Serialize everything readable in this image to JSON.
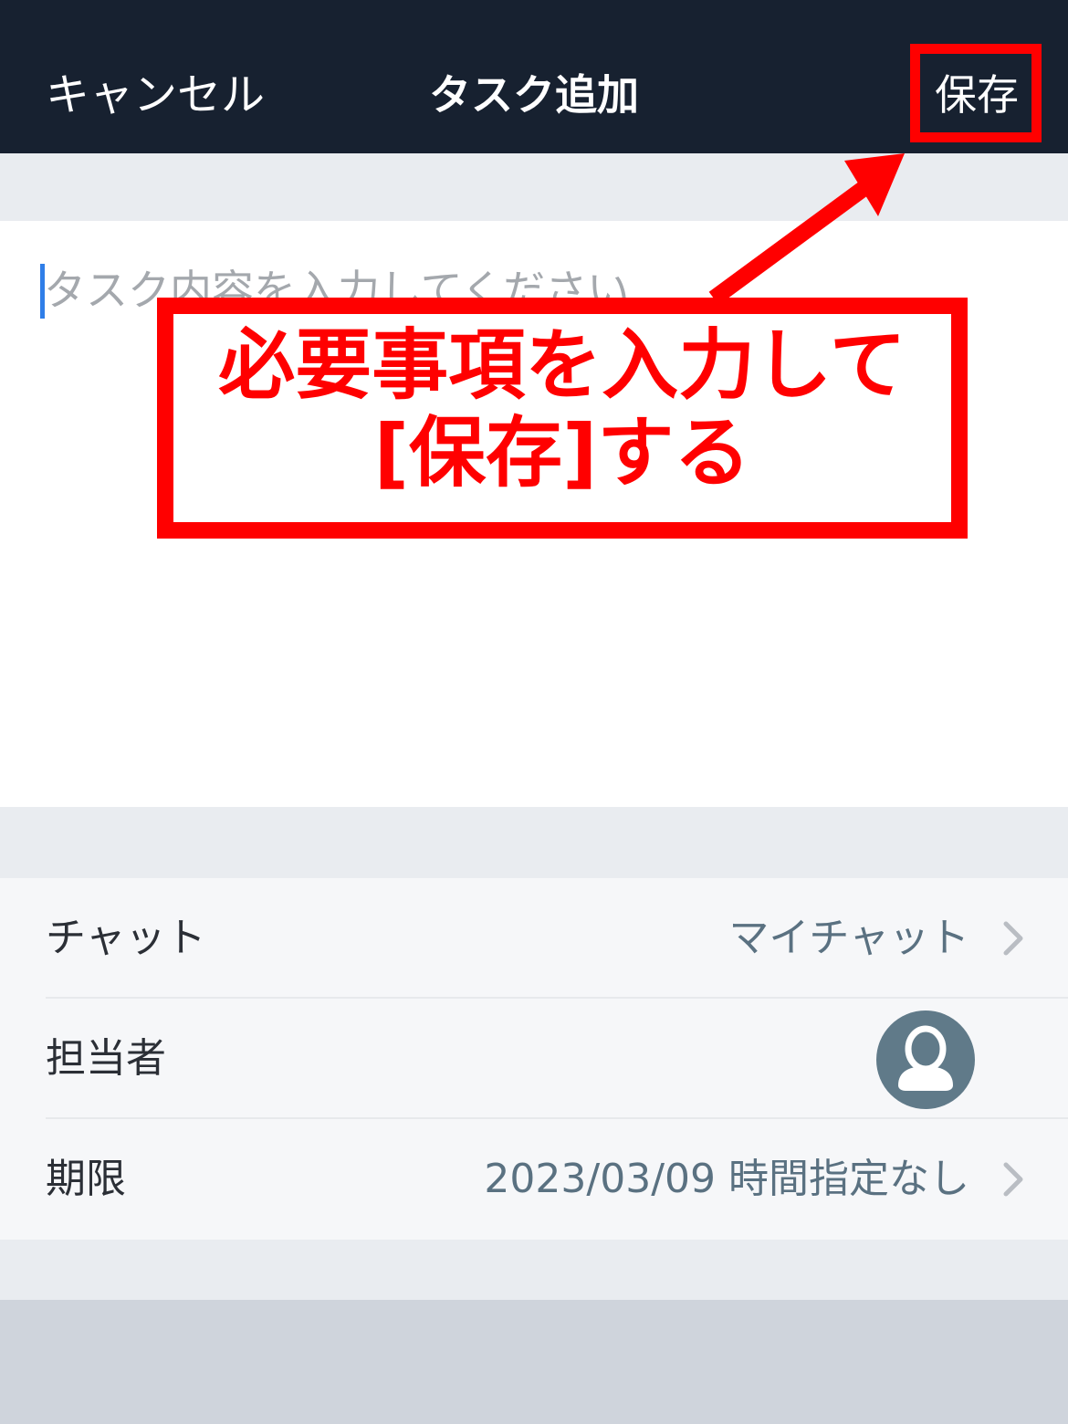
{
  "header": {
    "cancel_label": "キャンセル",
    "title": "タスク追加",
    "save_label": "保存"
  },
  "task": {
    "placeholder": "タスク内容を入力してください",
    "value": ""
  },
  "annotation": {
    "line1": "必要事項を入力して",
    "line2": "[保存]する",
    "color": "#ff0000"
  },
  "settings": {
    "chat": {
      "label": "チャット",
      "value": "マイチャット"
    },
    "assignee": {
      "label": "担当者",
      "avatar_icon": "person-avatar-icon"
    },
    "due": {
      "label": "期限",
      "value": "2023/03/09 時間指定なし"
    }
  },
  "colors": {
    "header_bg": "#172130",
    "accent_caret": "#2f7ee8",
    "value_text": "#5a7181",
    "avatar_bg": "#607a89"
  }
}
